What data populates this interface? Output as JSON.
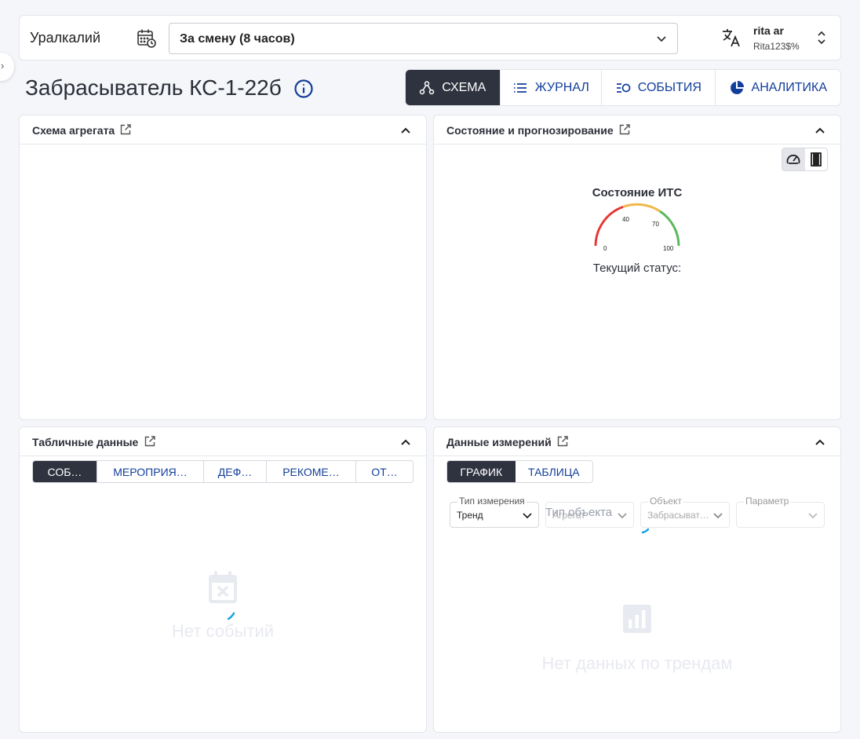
{
  "header": {
    "organization": "Уралкалий",
    "period": "За смену (8 часов)",
    "user_name": "rita ar",
    "user_login": "Rita123$%"
  },
  "page": {
    "title": "Забрасыватель КС-1-22б"
  },
  "view_tabs": [
    {
      "label": "СХЕМА",
      "icon": "schema-icon",
      "active": true
    },
    {
      "label": "ЖУРНАЛ",
      "icon": "list-icon",
      "active": false
    },
    {
      "label": "СОБЫТИЯ",
      "icon": "events-icon",
      "active": false
    },
    {
      "label": "АНАЛИТИКА",
      "icon": "pie-chart-icon",
      "active": false
    }
  ],
  "panels": {
    "schema": {
      "title": "Схема агрегата"
    },
    "state": {
      "title": "Состояние и прогнозирование",
      "gauge_title": "Состояние ИТС",
      "gauge_ticks": [
        "0",
        "40",
        "70",
        "100"
      ],
      "gauge_colors": {
        "low": "#e53935",
        "mid": "#f0b84a",
        "high": "#5cb85c"
      },
      "status_label": "Текущий статус:"
    },
    "table": {
      "title": "Табличные данные",
      "tabs": [
        "СОБ…",
        "МЕРОПРИЯ…",
        "ДЕФ…",
        "РЕКОМЕ…",
        "ОТ…"
      ],
      "empty_text": "Нет событий"
    },
    "measurements": {
      "title": "Данные измерений",
      "modes": [
        "ГРАФИК",
        "ТАБЛИЦА"
      ],
      "filters": {
        "measure_type": {
          "label": "Тип измерения",
          "value": "Тренд"
        },
        "object_type": {
          "label": "Тип объекта",
          "value": "Агрегат"
        },
        "object": {
          "label": "Объект",
          "value": "Забрасыват…"
        },
        "parameter": {
          "label": "Параметр",
          "value": ""
        }
      },
      "empty_text": "Нет данных по трендам"
    }
  },
  "colors": {
    "accent": "#123e9b",
    "active_tab": "#2f333f",
    "spinner": "#1aa3e0"
  }
}
